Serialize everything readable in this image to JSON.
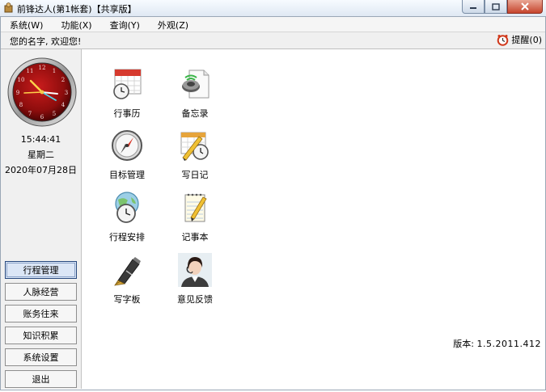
{
  "window": {
    "title": "前锋达人(第1帐套)【共享版】"
  },
  "menu": [
    {
      "label": "系统(W)"
    },
    {
      "label": "功能(X)"
    },
    {
      "label": "查询(Y)"
    },
    {
      "label": "外观(Z)"
    }
  ],
  "welcome": {
    "text": "您的名字, 欢迎您!"
  },
  "reminder": {
    "label": "提醒(0)",
    "icon": "alarm-clock-icon"
  },
  "clock": {
    "time": "15:44:41",
    "weekday": "星期二",
    "date": "2020年07月28日"
  },
  "nav": [
    {
      "label": "行程管理",
      "active": true
    },
    {
      "label": "人脉经营"
    },
    {
      "label": "账务往来"
    },
    {
      "label": "知识积累"
    },
    {
      "label": "系统设置"
    },
    {
      "label": "退出"
    }
  ],
  "apps": [
    {
      "label": "行事历",
      "icon": "calendar-clock-icon"
    },
    {
      "label": "备忘录",
      "icon": "memo-speaker-icon"
    },
    {
      "label": "目标管理",
      "icon": "compass-icon"
    },
    {
      "label": "写日记",
      "icon": "diary-pencil-clock-icon"
    },
    {
      "label": "行程安排",
      "icon": "globe-clock-icon"
    },
    {
      "label": "记事本",
      "icon": "notepad-pencil-icon"
    },
    {
      "label": "写字板",
      "icon": "fountain-pen-icon"
    },
    {
      "label": "意见反馈",
      "icon": "support-agent-photo-icon"
    }
  ],
  "version": {
    "label": "版本:",
    "value": "1.5.2011.412"
  },
  "colors": {
    "clock_face": "#8e0d0d",
    "active_nav_border": "#27487e",
    "close_button": "#c6442c"
  }
}
